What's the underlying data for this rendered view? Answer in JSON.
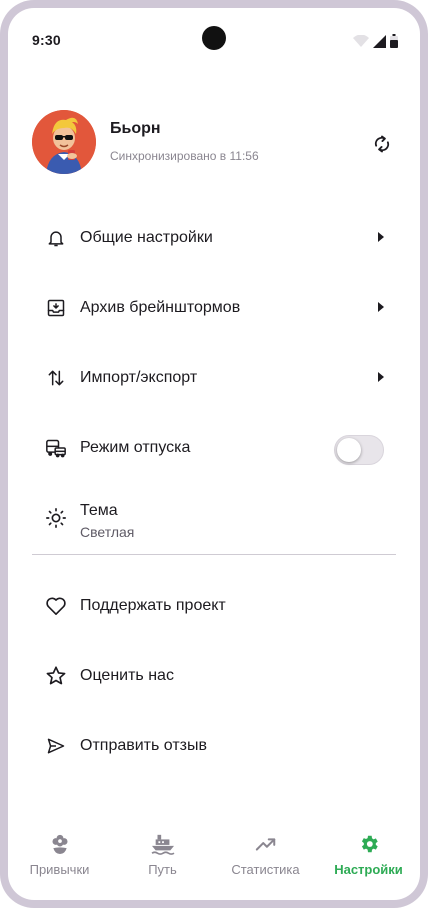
{
  "status_bar": {
    "time": "9:30"
  },
  "profile": {
    "name": "Бьорн",
    "sync_status": "Синхронизировано в 11:56"
  },
  "menu": {
    "general_settings": "Общие настройки",
    "brainstorm_archive": "Архив брейнштормов",
    "import_export": "Импорт/экспорт",
    "vacation_mode": "Режим отпуска",
    "vacation_mode_enabled": false,
    "theme_label": "Тема",
    "theme_value": "Светлая",
    "support": "Поддержать проект",
    "rate": "Оценить нас",
    "feedback": "Отправить отзыв"
  },
  "nav": {
    "habits": "Привычки",
    "path": "Путь",
    "stats": "Статистика",
    "settings": "Настройки",
    "active": "settings"
  },
  "colors": {
    "accent": "#2eab55",
    "frame": "#cfc7d6",
    "avatar_bg": "#e2573b"
  },
  "icons": {
    "general_settings": "bell-icon",
    "brainstorm_archive": "archive-icon",
    "import_export": "swap-vertical-icon",
    "vacation_mode": "bus-car-icon",
    "theme": "sun-icon",
    "support": "heart-icon",
    "rate": "star-icon",
    "feedback": "send-icon",
    "sync": "sync-icon",
    "habits": "flower-icon",
    "path": "ship-icon",
    "stats": "trending-up-icon",
    "settings": "gear-icon"
  }
}
